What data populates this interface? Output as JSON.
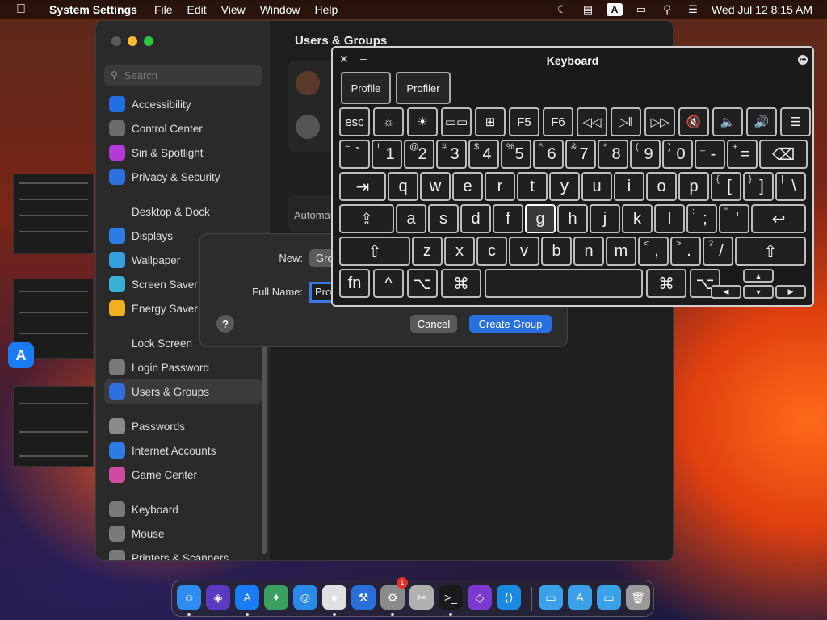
{
  "menubar": {
    "apple": "",
    "app_name": "System Settings",
    "menus": [
      "File",
      "Edit",
      "View",
      "Window",
      "Help"
    ],
    "input_source": "A",
    "datetime": "Wed Jul 12  8:15 AM"
  },
  "settings": {
    "search_placeholder": "Search",
    "title": "Users & Groups",
    "automatic_label": "Automa",
    "sidebar": [
      {
        "label": "Accessibility",
        "icon": "accessibility-icon",
        "color": "#1f6fe0"
      },
      {
        "label": "Control Center",
        "icon": "control-center-icon",
        "color": "#6b6b6b"
      },
      {
        "label": "Siri & Spotlight",
        "icon": "siri-icon",
        "color": "#b23ad6"
      },
      {
        "label": "Privacy & Security",
        "icon": "hand-icon",
        "color": "#2d6fdc"
      },
      {
        "label": "Desktop & Dock",
        "icon": "dock-icon",
        "color": "#2a2a2a"
      },
      {
        "label": "Displays",
        "icon": "displays-icon",
        "color": "#2d7be6"
      },
      {
        "label": "Wallpaper",
        "icon": "wallpaper-icon",
        "color": "#34a0e0"
      },
      {
        "label": "Screen Saver",
        "icon": "screen-saver-icon",
        "color": "#3ab0d8"
      },
      {
        "label": "Energy Saver",
        "icon": "energy-icon",
        "color": "#f0b020"
      },
      {
        "label": "Lock Screen",
        "icon": "lock-icon",
        "color": "#2a2a2a"
      },
      {
        "label": "Login Password",
        "icon": "password-icon",
        "color": "#7a7a7a"
      },
      {
        "label": "Users & Groups",
        "icon": "users-icon",
        "color": "#2d6fdc"
      },
      {
        "label": "Passwords",
        "icon": "key-icon",
        "color": "#8a8a8a"
      },
      {
        "label": "Internet Accounts",
        "icon": "at-icon",
        "color": "#2d7be6"
      },
      {
        "label": "Game Center",
        "icon": "game-center-icon",
        "color": "#d04aa0"
      },
      {
        "label": "Keyboard",
        "icon": "keyboard-icon",
        "color": "#7a7a7a"
      },
      {
        "label": "Mouse",
        "icon": "mouse-icon",
        "color": "#7a7a7a"
      },
      {
        "label": "Printers & Scanners",
        "icon": "printer-icon",
        "color": "#7a7a7a"
      }
    ]
  },
  "sheet": {
    "new_label": "New:",
    "new_value": "Gro",
    "fullname_label": "Full Name:",
    "fullname_value": "Prof",
    "help": "?",
    "cancel": "Cancel",
    "create": "Create Group"
  },
  "keyboard": {
    "title": "Keyboard",
    "profile_buttons": [
      "Profile",
      "Profiler"
    ],
    "fn_row": [
      "esc",
      "☼",
      "☀",
      "▭▭",
      "⊞",
      "F5",
      "F6",
      "◁◁",
      "▷‖",
      "▷▷",
      "🔇",
      "🔈",
      "🔊",
      "☰"
    ],
    "row1": [
      [
        "~",
        "`"
      ],
      [
        "!",
        "1"
      ],
      [
        "@",
        "2"
      ],
      [
        "#",
        "3"
      ],
      [
        "$",
        "4"
      ],
      [
        "%",
        "5"
      ],
      [
        "^",
        "6"
      ],
      [
        "&",
        "7"
      ],
      [
        "*",
        "8"
      ],
      [
        "(",
        "9"
      ],
      [
        ")",
        "0"
      ],
      [
        "_",
        "-"
      ],
      [
        "+",
        "="
      ],
      [
        "",
        "⌫"
      ]
    ],
    "row2": [
      [
        "",
        "⇥"
      ],
      [
        "",
        "q"
      ],
      [
        "",
        "w"
      ],
      [
        "",
        "e"
      ],
      [
        "",
        "r"
      ],
      [
        "",
        "t"
      ],
      [
        "",
        "y"
      ],
      [
        "",
        "u"
      ],
      [
        "",
        "i"
      ],
      [
        "",
        "o"
      ],
      [
        "",
        "p"
      ],
      [
        "{",
        "["
      ],
      [
        "}",
        "]"
      ],
      [
        "|",
        "\\"
      ]
    ],
    "row3": [
      [
        "",
        "⇪"
      ],
      [
        "",
        "a"
      ],
      [
        "",
        "s"
      ],
      [
        "",
        "d"
      ],
      [
        "",
        "f"
      ],
      [
        "",
        "g"
      ],
      [
        "",
        "h"
      ],
      [
        "",
        "j"
      ],
      [
        "",
        "k"
      ],
      [
        "",
        "l"
      ],
      [
        ":",
        ";"
      ],
      [
        "\"",
        "'"
      ],
      [
        "",
        "↩"
      ]
    ],
    "row4": [
      [
        "",
        "⇧"
      ],
      [
        "",
        "z"
      ],
      [
        "",
        "x"
      ],
      [
        "",
        "c"
      ],
      [
        "",
        "v"
      ],
      [
        "",
        "b"
      ],
      [
        "",
        "n"
      ],
      [
        "",
        "m"
      ],
      [
        "<",
        ","
      ],
      [
        ">",
        "."
      ],
      [
        "?",
        "/"
      ],
      [
        "",
        "⇧"
      ]
    ],
    "row5": [
      "fn",
      "^",
      "⌥",
      "⌘",
      "",
      "⌘",
      "⌥"
    ],
    "arrows": [
      "▲",
      "◀",
      "▼",
      "▶"
    ]
  },
  "dock": [
    {
      "name": "finder-icon",
      "color": "#2f8cf0",
      "glyph": "☺",
      "running": true
    },
    {
      "name": "shortcuts-icon",
      "color": "#5a3ac0",
      "glyph": "◈",
      "running": false
    },
    {
      "name": "app-store-icon",
      "color": "#1a7cf5",
      "glyph": "A",
      "running": true
    },
    {
      "name": "maps-icon",
      "color": "#3aa060",
      "glyph": "✦",
      "running": false
    },
    {
      "name": "safari-icon",
      "color": "#2a8ae8",
      "glyph": "◎",
      "running": false
    },
    {
      "name": "chrome-icon",
      "color": "#e0e0e0",
      "glyph": "●",
      "running": true
    },
    {
      "name": "xcode-icon",
      "color": "#2a6fd8",
      "glyph": "⚒",
      "running": false
    },
    {
      "name": "system-settings-icon",
      "color": "#8a8a8a",
      "glyph": "⚙",
      "running": true
    },
    {
      "name": "utility-icon",
      "color": "#b0b0b0",
      "glyph": "✂",
      "running": false
    },
    {
      "name": "terminal-icon",
      "color": "#1a1a1a",
      "glyph": ">_",
      "running": true
    },
    {
      "name": "visual-studio-icon",
      "color": "#7a3ad0",
      "glyph": "◇",
      "running": false
    },
    {
      "name": "vscode-icon",
      "color": "#1a8ae0",
      "glyph": "⟨⟩",
      "running": false
    },
    {
      "name": "folder-icon",
      "color": "#3aa0e8",
      "glyph": "▭",
      "running": false
    },
    {
      "name": "applications-folder-icon",
      "color": "#3aa0e8",
      "glyph": "A",
      "running": false
    },
    {
      "name": "downloads-folder-icon",
      "color": "#3aa0e8",
      "glyph": "▭",
      "running": false
    },
    {
      "name": "trash-icon",
      "color": "#9a9a9a",
      "glyph": "🗑",
      "running": false
    }
  ],
  "dock_badge": "1"
}
